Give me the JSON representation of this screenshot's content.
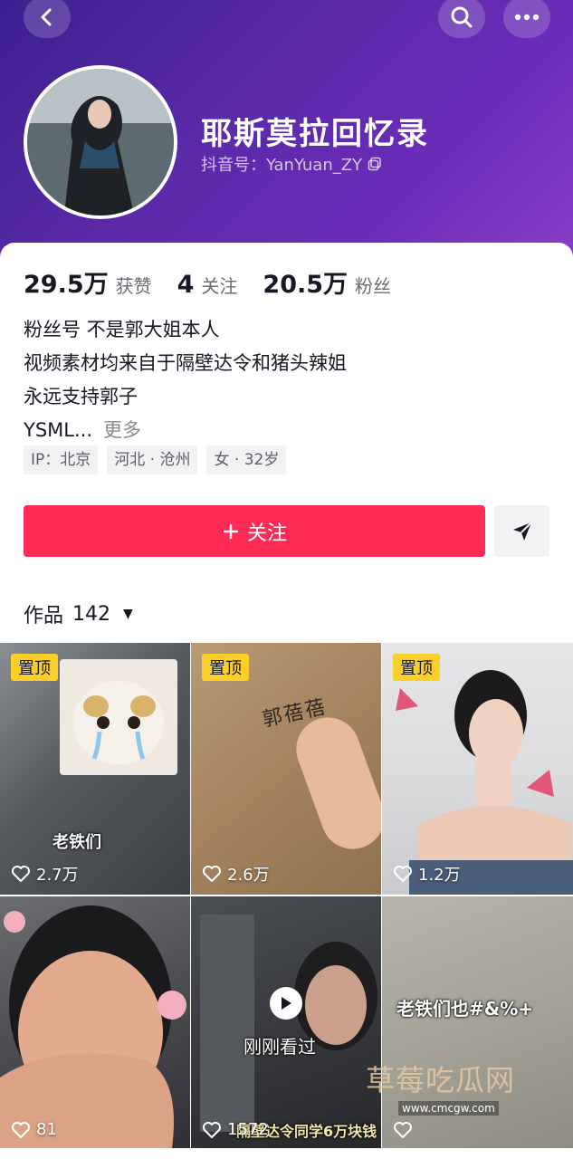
{
  "header": {
    "name": "耶斯莫拉回忆录",
    "douyin_id": "抖音号：YanYuan_ZY",
    "gradient": [
      "#3b1f8f",
      "#8a3fc8"
    ]
  },
  "stats": [
    {
      "num": "29.5万",
      "label": "获赞"
    },
    {
      "num": "4",
      "label": "关注"
    },
    {
      "num": "20.5万",
      "label": "粉丝"
    }
  ],
  "bio": {
    "lines": [
      "粉丝号 不是郭大姐本人",
      "视频素材均来自于隔壁达令和猪头辣姐",
      "永远支持郭子"
    ],
    "last": "YSML...",
    "more": "更多"
  },
  "tags": [
    "IP：北京",
    "河北 · 沧州",
    "女 · 32岁"
  ],
  "actions": {
    "follow": "关注",
    "follow_icon": "plus-icon",
    "share_icon": "send-icon",
    "accent": "#fe2c55"
  },
  "works": {
    "label": "作品",
    "count": "142"
  },
  "videos": [
    {
      "pinned": "置顶",
      "likes": "2.7万",
      "overlay": "老铁们"
    },
    {
      "pinned": "置顶",
      "likes": "2.6万",
      "overlay": "郭蓓蓓"
    },
    {
      "pinned": "置顶",
      "likes": "1.2万",
      "overlay": ""
    },
    {
      "pinned": "",
      "likes": "81",
      "overlay": ""
    },
    {
      "pinned": "",
      "likes": "1572",
      "overlay": "刚刚看过",
      "subtitle": "隔壁达令同学6万块钱"
    },
    {
      "pinned": "",
      "likes": "",
      "overlay": "老铁们也#&%+"
    }
  ],
  "watermark": {
    "title": "草莓吃瓜网",
    "url": "www.cmcgw.com"
  }
}
